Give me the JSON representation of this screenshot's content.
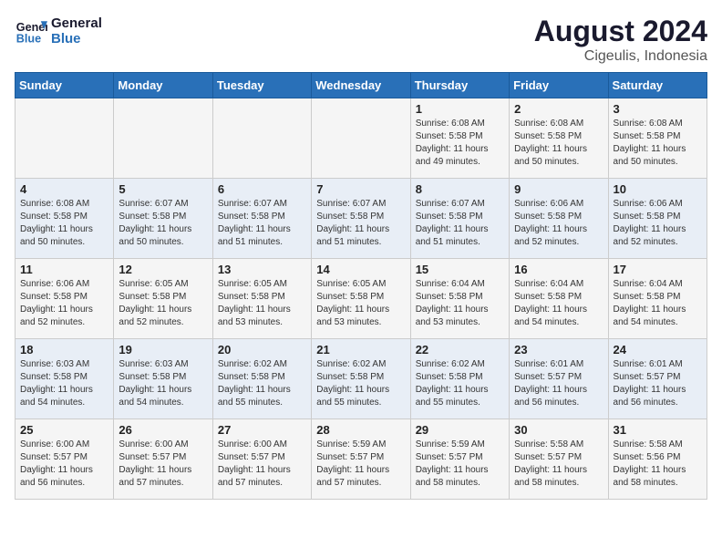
{
  "logo": {
    "line1": "General",
    "line2": "Blue"
  },
  "title": "August 2024",
  "subtitle": "Cigeulis, Indonesia",
  "headers": [
    "Sunday",
    "Monday",
    "Tuesday",
    "Wednesday",
    "Thursday",
    "Friday",
    "Saturday"
  ],
  "weeks": [
    [
      {
        "day": "",
        "text": ""
      },
      {
        "day": "",
        "text": ""
      },
      {
        "day": "",
        "text": ""
      },
      {
        "day": "",
        "text": ""
      },
      {
        "day": "1",
        "text": "Sunrise: 6:08 AM\nSunset: 5:58 PM\nDaylight: 11 hours\nand 49 minutes."
      },
      {
        "day": "2",
        "text": "Sunrise: 6:08 AM\nSunset: 5:58 PM\nDaylight: 11 hours\nand 50 minutes."
      },
      {
        "day": "3",
        "text": "Sunrise: 6:08 AM\nSunset: 5:58 PM\nDaylight: 11 hours\nand 50 minutes."
      }
    ],
    [
      {
        "day": "4",
        "text": "Sunrise: 6:08 AM\nSunset: 5:58 PM\nDaylight: 11 hours\nand 50 minutes."
      },
      {
        "day": "5",
        "text": "Sunrise: 6:07 AM\nSunset: 5:58 PM\nDaylight: 11 hours\nand 50 minutes."
      },
      {
        "day": "6",
        "text": "Sunrise: 6:07 AM\nSunset: 5:58 PM\nDaylight: 11 hours\nand 51 minutes."
      },
      {
        "day": "7",
        "text": "Sunrise: 6:07 AM\nSunset: 5:58 PM\nDaylight: 11 hours\nand 51 minutes."
      },
      {
        "day": "8",
        "text": "Sunrise: 6:07 AM\nSunset: 5:58 PM\nDaylight: 11 hours\nand 51 minutes."
      },
      {
        "day": "9",
        "text": "Sunrise: 6:06 AM\nSunset: 5:58 PM\nDaylight: 11 hours\nand 52 minutes."
      },
      {
        "day": "10",
        "text": "Sunrise: 6:06 AM\nSunset: 5:58 PM\nDaylight: 11 hours\nand 52 minutes."
      }
    ],
    [
      {
        "day": "11",
        "text": "Sunrise: 6:06 AM\nSunset: 5:58 PM\nDaylight: 11 hours\nand 52 minutes."
      },
      {
        "day": "12",
        "text": "Sunrise: 6:05 AM\nSunset: 5:58 PM\nDaylight: 11 hours\nand 52 minutes."
      },
      {
        "day": "13",
        "text": "Sunrise: 6:05 AM\nSunset: 5:58 PM\nDaylight: 11 hours\nand 53 minutes."
      },
      {
        "day": "14",
        "text": "Sunrise: 6:05 AM\nSunset: 5:58 PM\nDaylight: 11 hours\nand 53 minutes."
      },
      {
        "day": "15",
        "text": "Sunrise: 6:04 AM\nSunset: 5:58 PM\nDaylight: 11 hours\nand 53 minutes."
      },
      {
        "day": "16",
        "text": "Sunrise: 6:04 AM\nSunset: 5:58 PM\nDaylight: 11 hours\nand 54 minutes."
      },
      {
        "day": "17",
        "text": "Sunrise: 6:04 AM\nSunset: 5:58 PM\nDaylight: 11 hours\nand 54 minutes."
      }
    ],
    [
      {
        "day": "18",
        "text": "Sunrise: 6:03 AM\nSunset: 5:58 PM\nDaylight: 11 hours\nand 54 minutes."
      },
      {
        "day": "19",
        "text": "Sunrise: 6:03 AM\nSunset: 5:58 PM\nDaylight: 11 hours\nand 54 minutes."
      },
      {
        "day": "20",
        "text": "Sunrise: 6:02 AM\nSunset: 5:58 PM\nDaylight: 11 hours\nand 55 minutes."
      },
      {
        "day": "21",
        "text": "Sunrise: 6:02 AM\nSunset: 5:58 PM\nDaylight: 11 hours\nand 55 minutes."
      },
      {
        "day": "22",
        "text": "Sunrise: 6:02 AM\nSunset: 5:58 PM\nDaylight: 11 hours\nand 55 minutes."
      },
      {
        "day": "23",
        "text": "Sunrise: 6:01 AM\nSunset: 5:57 PM\nDaylight: 11 hours\nand 56 minutes."
      },
      {
        "day": "24",
        "text": "Sunrise: 6:01 AM\nSunset: 5:57 PM\nDaylight: 11 hours\nand 56 minutes."
      }
    ],
    [
      {
        "day": "25",
        "text": "Sunrise: 6:00 AM\nSunset: 5:57 PM\nDaylight: 11 hours\nand 56 minutes."
      },
      {
        "day": "26",
        "text": "Sunrise: 6:00 AM\nSunset: 5:57 PM\nDaylight: 11 hours\nand 57 minutes."
      },
      {
        "day": "27",
        "text": "Sunrise: 6:00 AM\nSunset: 5:57 PM\nDaylight: 11 hours\nand 57 minutes."
      },
      {
        "day": "28",
        "text": "Sunrise: 5:59 AM\nSunset: 5:57 PM\nDaylight: 11 hours\nand 57 minutes."
      },
      {
        "day": "29",
        "text": "Sunrise: 5:59 AM\nSunset: 5:57 PM\nDaylight: 11 hours\nand 58 minutes."
      },
      {
        "day": "30",
        "text": "Sunrise: 5:58 AM\nSunset: 5:57 PM\nDaylight: 11 hours\nand 58 minutes."
      },
      {
        "day": "31",
        "text": "Sunrise: 5:58 AM\nSunset: 5:56 PM\nDaylight: 11 hours\nand 58 minutes."
      }
    ]
  ]
}
